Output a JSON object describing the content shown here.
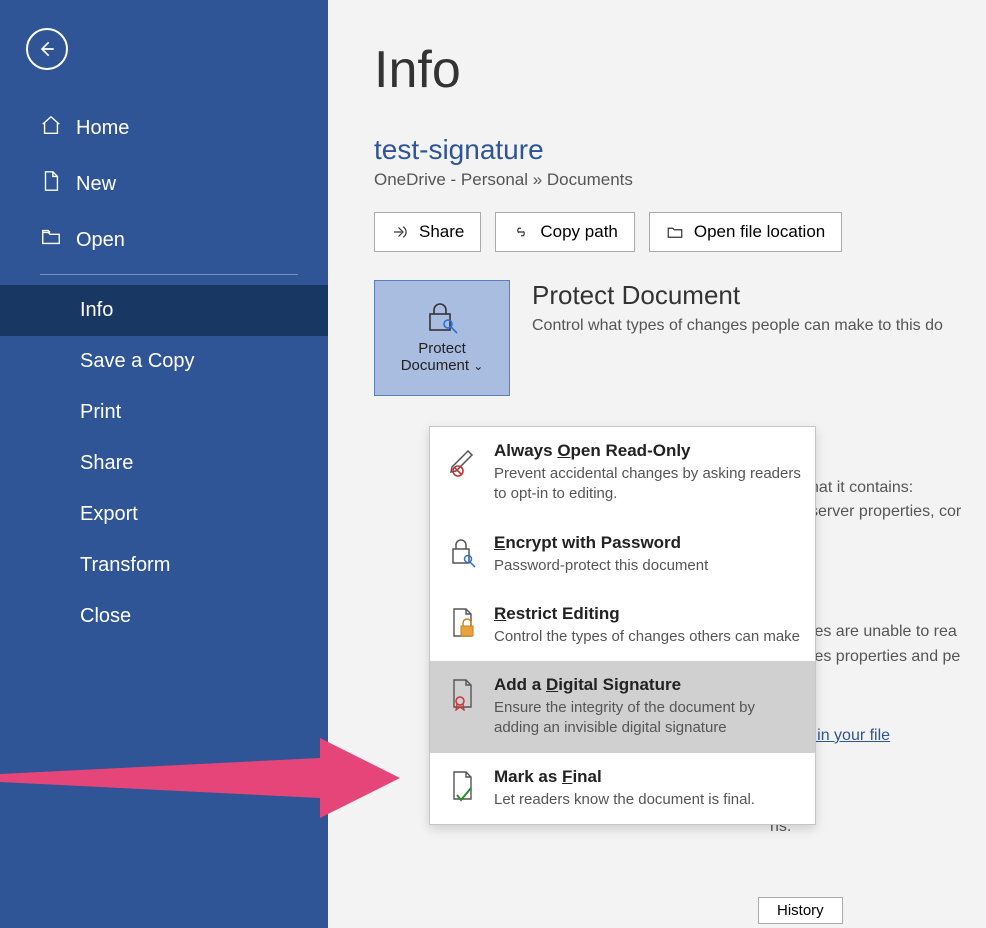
{
  "sidebar": {
    "home": "Home",
    "new": "New",
    "open": "Open",
    "items": [
      "Info",
      "Save a Copy",
      "Print",
      "Share",
      "Export",
      "Transform",
      "Close"
    ]
  },
  "main": {
    "page_title": "Info",
    "doc_title": "test-signature",
    "breadcrumb": "OneDrive - Personal » Documents",
    "actions": {
      "share": "Share",
      "copy_path": "Copy path",
      "open_loc": "Open file location"
    },
    "protect": {
      "tile_line1": "Protect",
      "tile_line2": "Document",
      "heading": "Protect Document",
      "desc": "Control what types of changes people can make to this do"
    }
  },
  "dropdown": [
    {
      "title_pre": "Always ",
      "title_ul": "O",
      "title_post": "pen Read-Only",
      "desc": "Prevent accidental changes by asking readers to opt-in to editing."
    },
    {
      "title_pre": "",
      "title_ul": "E",
      "title_post": "ncrypt with Password",
      "desc": "Password-protect this document"
    },
    {
      "title_pre": "",
      "title_ul": "R",
      "title_post": "estrict Editing",
      "desc": "Control the types of changes others can make"
    },
    {
      "title_pre": "Add a ",
      "title_ul": "D",
      "title_post": "igital Signature",
      "desc": "Ensure the integrity of the document by adding an invisible digital signature"
    },
    {
      "title_pre": "Mark as ",
      "title_ul": "F",
      "title_post": "inal",
      "desc": "Let readers know the document is final."
    }
  ],
  "bg": {
    "line1": "vare that it contains:",
    "line2": "ment server properties, cor",
    "line3": "sabilities are unable to rea",
    "line4": "removes properties and pe",
    "link": "saved in your file",
    "line5": "ns.",
    "history": "History"
  }
}
